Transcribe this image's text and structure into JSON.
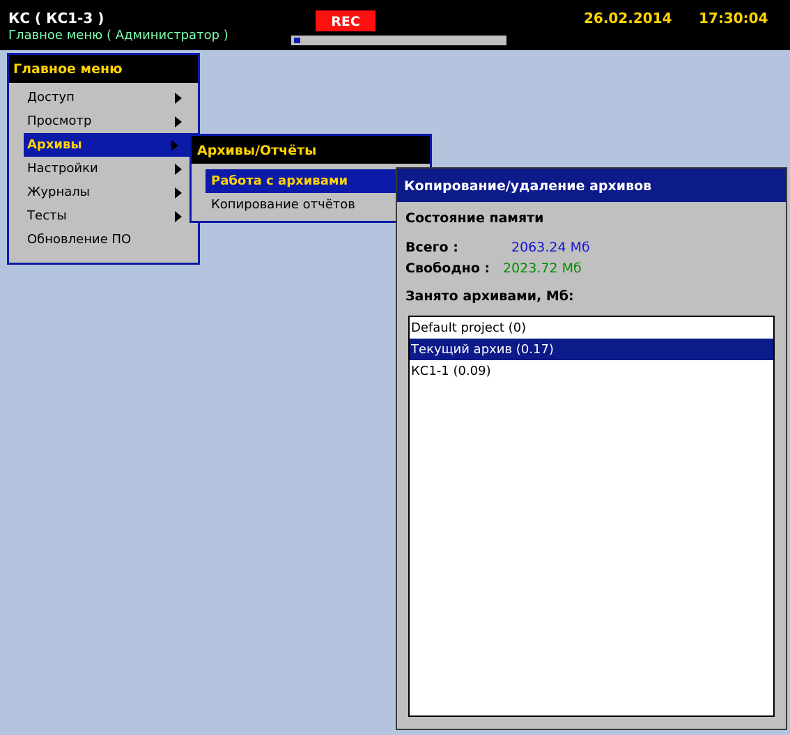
{
  "topbar": {
    "title": "КС ( КС1-3 )",
    "rec": "REC",
    "date": "26.02.2014",
    "time": "17:30:04",
    "subtitle": "Главное меню ( Администратор )",
    "progress_fraction": 0.03
  },
  "main_menu": {
    "title": "Главное меню",
    "items": [
      {
        "label": "Доступ",
        "has_submenu": true
      },
      {
        "label": "Просмотр",
        "has_submenu": true
      },
      {
        "label": "Архивы",
        "has_submenu": true,
        "selected": true
      },
      {
        "label": "Настройки",
        "has_submenu": true
      },
      {
        "label": "Журналы",
        "has_submenu": true
      },
      {
        "label": "Тесты",
        "has_submenu": true
      },
      {
        "label": "Обновление ПО",
        "has_submenu": false
      }
    ]
  },
  "archives_menu": {
    "title": "Архивы/Отчёты",
    "items": [
      {
        "label": "Работа с архивами",
        "selected": true
      },
      {
        "label": "Копирование отчётов"
      }
    ]
  },
  "dialog": {
    "title": "Копирование/удаление архивов",
    "memory_state_label": "Состояние памяти",
    "total_label": "Всего :",
    "total_value": "2063.24 Мб",
    "free_label": "Свободно :",
    "free_value": "2023.72 Мб",
    "occupied_label": "Занято архивами, Мб:",
    "archives": [
      {
        "label": "Default project (0)"
      },
      {
        "label": "Текущий архив (0.17)",
        "selected": true
      },
      {
        "label": "КС1-1 (0.09)"
      }
    ]
  },
  "colors": {
    "background": "#b4c4de",
    "accent_blue": "#0c1aa8",
    "header_yellow": "#ffd400",
    "rec_red": "#ff1010",
    "total_blue": "#1515d0",
    "free_green": "#008a00"
  }
}
